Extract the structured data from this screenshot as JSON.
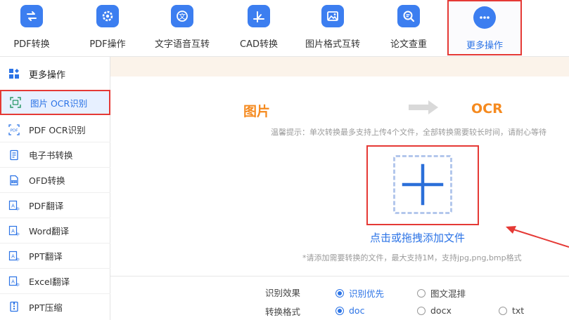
{
  "toolbar": {
    "items": [
      {
        "label": "PDF转换"
      },
      {
        "label": "PDF操作"
      },
      {
        "label": "文字语音互转"
      },
      {
        "label": "CAD转换"
      },
      {
        "label": "图片格式互转"
      },
      {
        "label": "论文查重"
      },
      {
        "label": "更多操作"
      }
    ],
    "active_index": 6,
    "accent_color": "#3c7ef0"
  },
  "sidebar": {
    "header": "更多操作",
    "items": [
      {
        "label": "图片 OCR识别",
        "selected": true
      },
      {
        "label": "PDF OCR识别"
      },
      {
        "label": "电子书转换"
      },
      {
        "label": "OFD转换"
      },
      {
        "label": "PDF翻译"
      },
      {
        "label": "Word翻译"
      },
      {
        "label": "PPT翻译"
      },
      {
        "label": "Excel翻译"
      },
      {
        "label": "PPT压缩"
      }
    ]
  },
  "main": {
    "flow": {
      "from": "图片",
      "to": "OCR"
    },
    "tip": "温馨提示：单次转换最多支持上传4个文件，全部转换需要较长时间，请耐心等待",
    "upload_label": "点击或拖拽添加文件",
    "upload_hint": "*请添加需要转换的文件，最大支持1M，支持jpg,png,bmp格式",
    "options": {
      "recognition": {
        "label": "识别效果",
        "choices": [
          "识别优先",
          "图文混排"
        ],
        "selected": "识别优先"
      },
      "format": {
        "label": "转换格式",
        "choices": [
          "doc",
          "docx",
          "txt"
        ],
        "selected": "doc"
      }
    }
  },
  "colors": {
    "highlight_red": "#e53935",
    "brand_blue": "#2b73e6",
    "orange": "#f58a1f"
  }
}
